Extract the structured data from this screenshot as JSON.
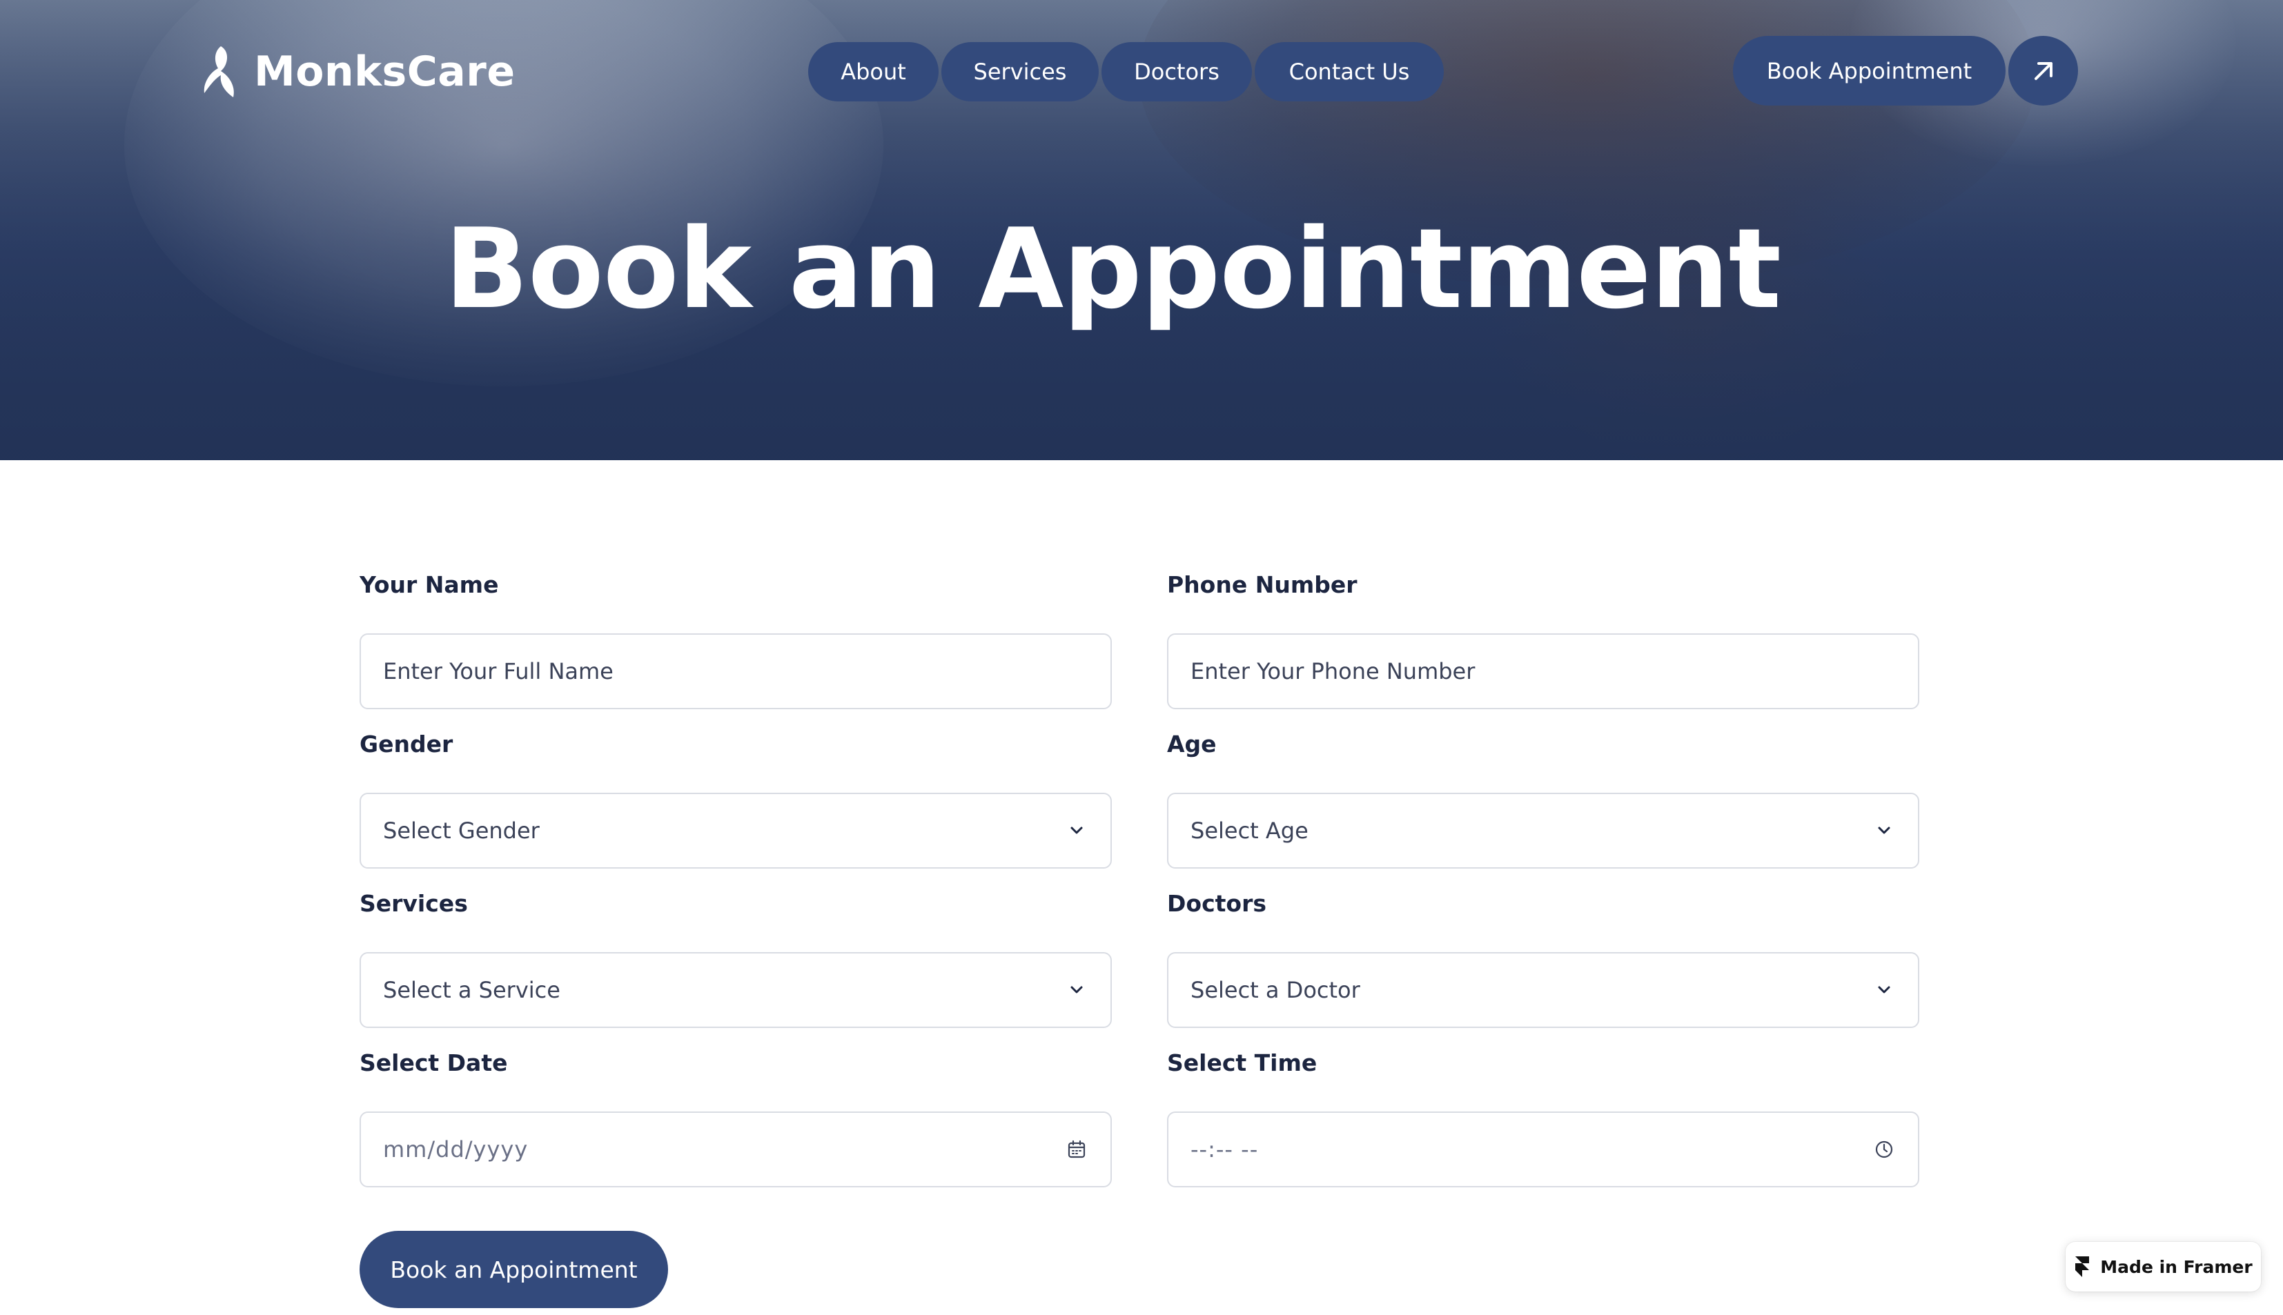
{
  "brand": {
    "name": "MonksCare",
    "logo_icon": "monkscare-leaf-logo-icon"
  },
  "nav": {
    "items": [
      {
        "label": "About"
      },
      {
        "label": "Services"
      },
      {
        "label": "Doctors"
      },
      {
        "label": "Contact Us"
      }
    ]
  },
  "header": {
    "cta_label": "Book Appointment",
    "cta_icon": "arrow-up-right-icon"
  },
  "hero": {
    "title": "Book an Appointment"
  },
  "form": {
    "name": {
      "label": "Your Name",
      "placeholder": "Enter Your Full Name"
    },
    "phone": {
      "label": "Phone Number",
      "placeholder": "Enter Your Phone Number"
    },
    "gender": {
      "label": "Gender",
      "value": "Select Gender"
    },
    "age": {
      "label": "Age",
      "value": "Select Age"
    },
    "service": {
      "label": "Services",
      "value": "Select a Service"
    },
    "doctor": {
      "label": "Doctors",
      "value": "Select a Doctor"
    },
    "date": {
      "label": "Select Date",
      "placeholder": "mm/dd/yyyy"
    },
    "time": {
      "label": "Select Time",
      "placeholder": "--:-- --"
    },
    "submit_label": "Book an Appointment"
  },
  "badge": {
    "label": "Made in Framer"
  },
  "colors": {
    "primary": "#334a7c",
    "hero_dark": "#26375b",
    "text": "#1c2540",
    "border": "#d9dce3"
  }
}
